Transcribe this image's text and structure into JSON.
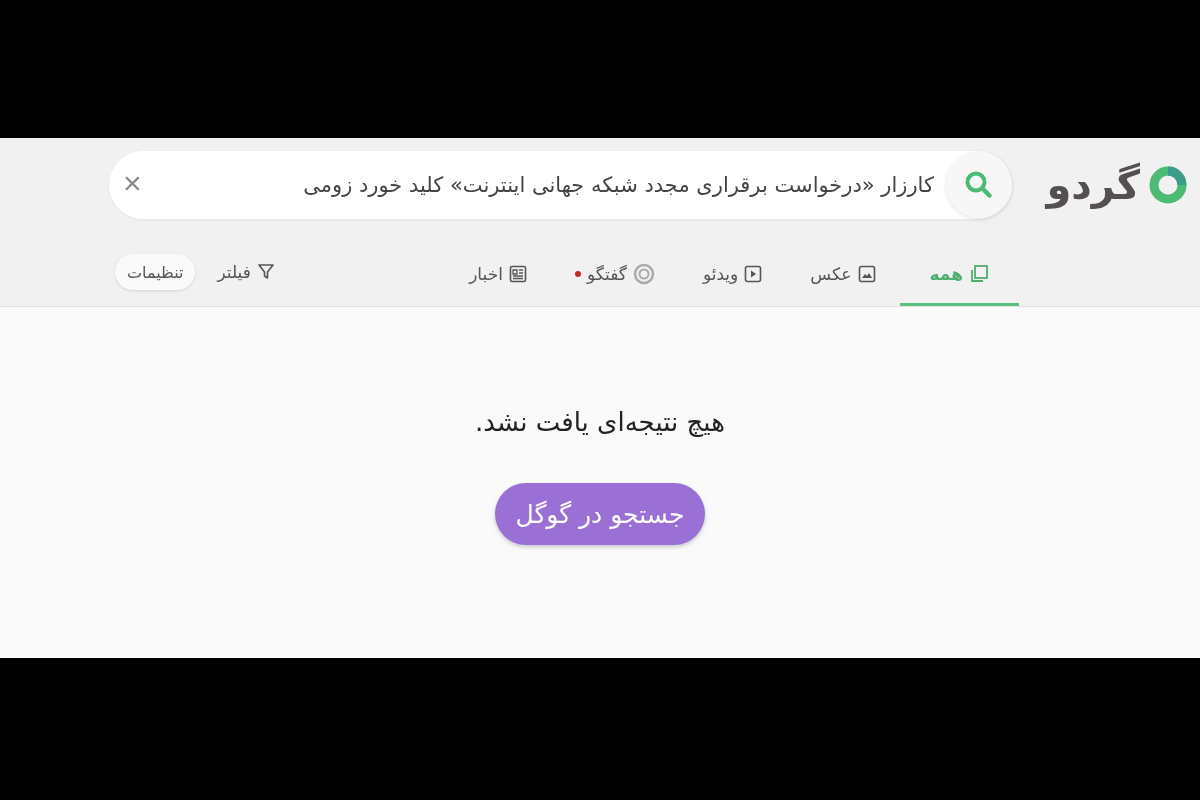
{
  "logo": {
    "text": "گردو"
  },
  "search": {
    "value": "کارزار «درخواست برقراری مجدد شبکه جهانی اینترنت» کلید خورد زومی",
    "clear": "×"
  },
  "tabs": [
    {
      "kind": "all",
      "label": "همه",
      "selected": true
    },
    {
      "kind": "image",
      "label": "عکس",
      "selected": false
    },
    {
      "kind": "video",
      "label": "ویدئو",
      "selected": false
    },
    {
      "kind": "chat",
      "label": "گفتگو",
      "selected": false,
      "dot": true
    },
    {
      "kind": "news",
      "label": "اخبار",
      "selected": false
    }
  ],
  "filter": {
    "label": "فیلتر"
  },
  "settings": {
    "label": "تنظیمات"
  },
  "message": "هیچ نتیجه‌ای یافت نشد.",
  "google_button": "جستجو در گوگل"
}
